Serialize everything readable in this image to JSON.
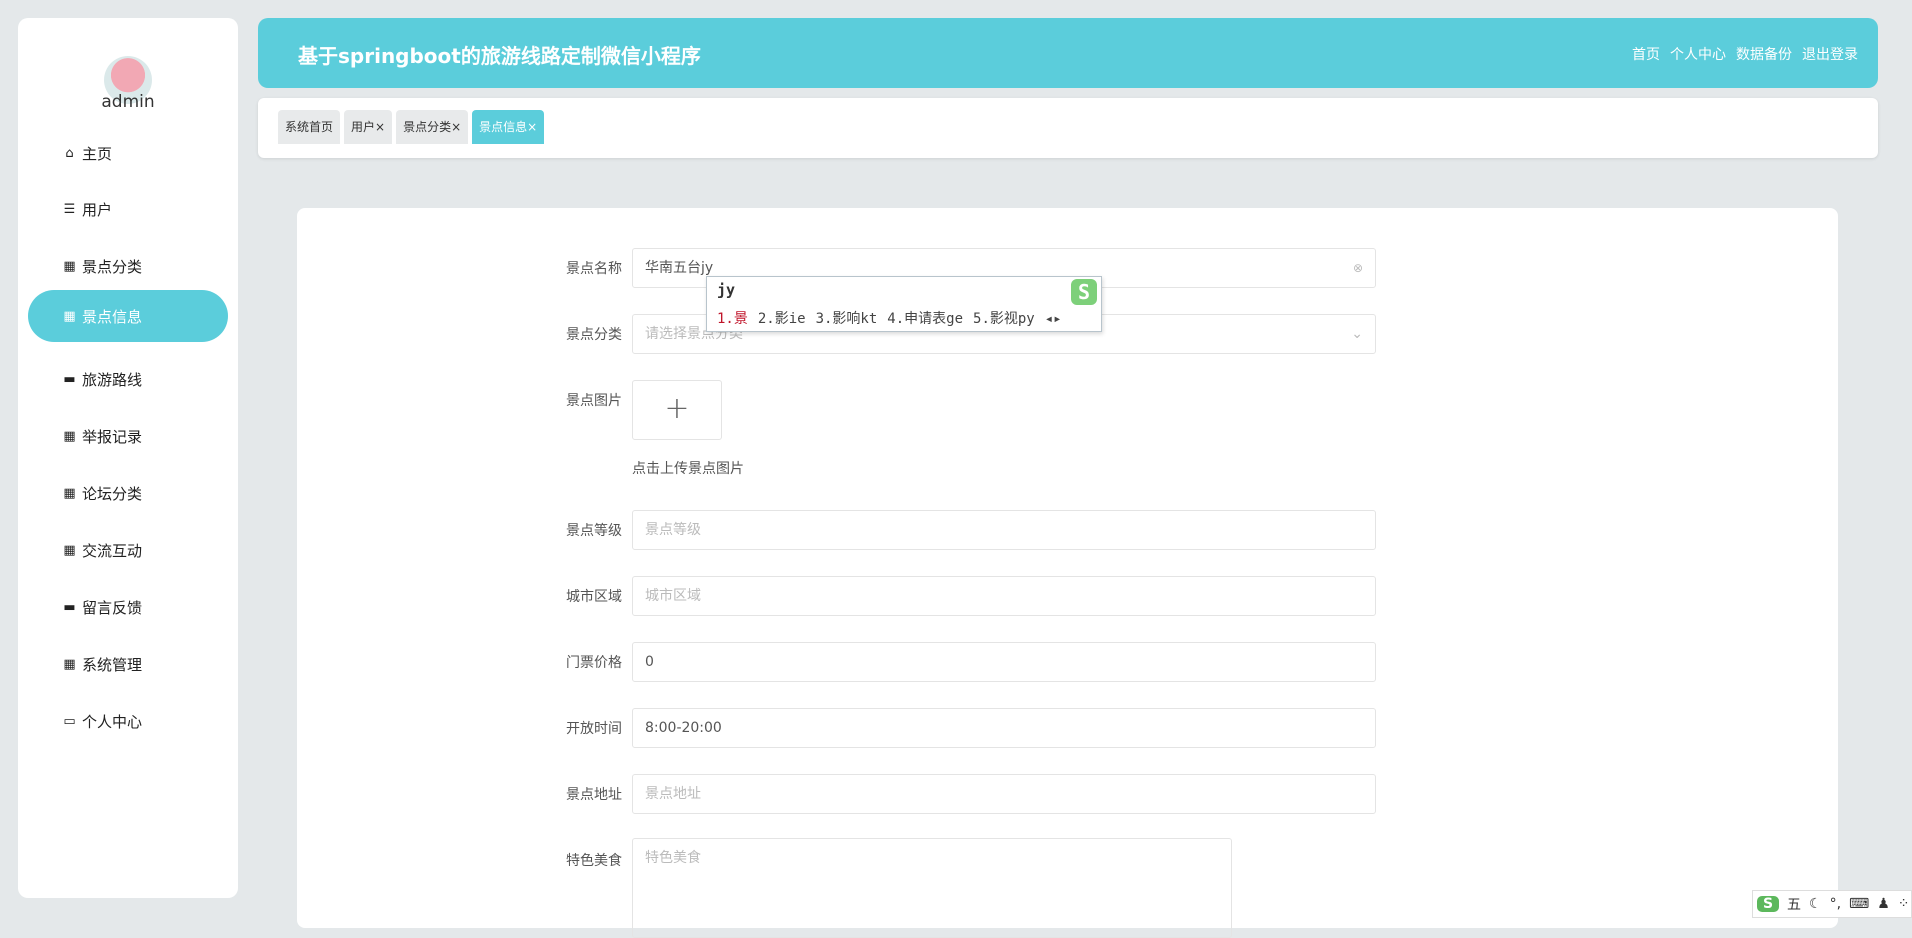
{
  "user": {
    "name": "admin"
  },
  "sidebar": {
    "items": [
      {
        "label": "主页",
        "icon": "home-icon",
        "glyph": "⌂"
      },
      {
        "label": "用户",
        "icon": "list-icon",
        "glyph": "☰"
      },
      {
        "label": "景点分类",
        "icon": "grid-icon",
        "glyph": "▦"
      },
      {
        "label": "景点信息",
        "icon": "grid-icon",
        "glyph": "▦",
        "active": true
      },
      {
        "label": "旅游路线",
        "icon": "bus-icon",
        "glyph": "▬"
      },
      {
        "label": "举报记录",
        "icon": "grid-icon",
        "glyph": "▦"
      },
      {
        "label": "论坛分类",
        "icon": "apps-icon",
        "glyph": "▦"
      },
      {
        "label": "交流互动",
        "icon": "grid-icon",
        "glyph": "▦"
      },
      {
        "label": "留言反馈",
        "icon": "briefcase-icon",
        "glyph": "▬"
      },
      {
        "label": "系统管理",
        "icon": "grid-icon",
        "glyph": "▦"
      },
      {
        "label": "个人中心",
        "icon": "card-icon",
        "glyph": "▭"
      }
    ]
  },
  "header": {
    "title": "基于springboot的旅游线路定制微信小程序",
    "nav": [
      "首页",
      "个人中心",
      "数据备份",
      "退出登录"
    ]
  },
  "tabs": [
    {
      "label": "系统首页"
    },
    {
      "label": "用户×"
    },
    {
      "label": "景点分类×"
    },
    {
      "label": "景点信息×",
      "active": true
    }
  ],
  "form": {
    "name": {
      "label": "景点名称",
      "value": "华南五台jy"
    },
    "category": {
      "label": "景点分类",
      "placeholder": "请选择景点分类"
    },
    "image": {
      "label": "景点图片",
      "hint": "点击上传景点图片",
      "plus": "+"
    },
    "level": {
      "label": "景点等级",
      "placeholder": "景点等级"
    },
    "city": {
      "label": "城市区域",
      "placeholder": "城市区域"
    },
    "price": {
      "label": "门票价格",
      "value": "0"
    },
    "hours": {
      "label": "开放时间",
      "value": "8:00-20:00"
    },
    "address": {
      "label": "景点地址",
      "placeholder": "景点地址"
    },
    "food": {
      "label": "特色美食",
      "placeholder": "特色美食"
    }
  },
  "ime": {
    "composition": "jy",
    "candidates": [
      "1.景",
      "2.影ie",
      "3.影响kt",
      "4.申请表ge",
      "5.影视py"
    ],
    "logo": "S",
    "tray": [
      "五",
      "☾",
      "°,",
      "⌨",
      "♟",
      "⁘"
    ]
  }
}
